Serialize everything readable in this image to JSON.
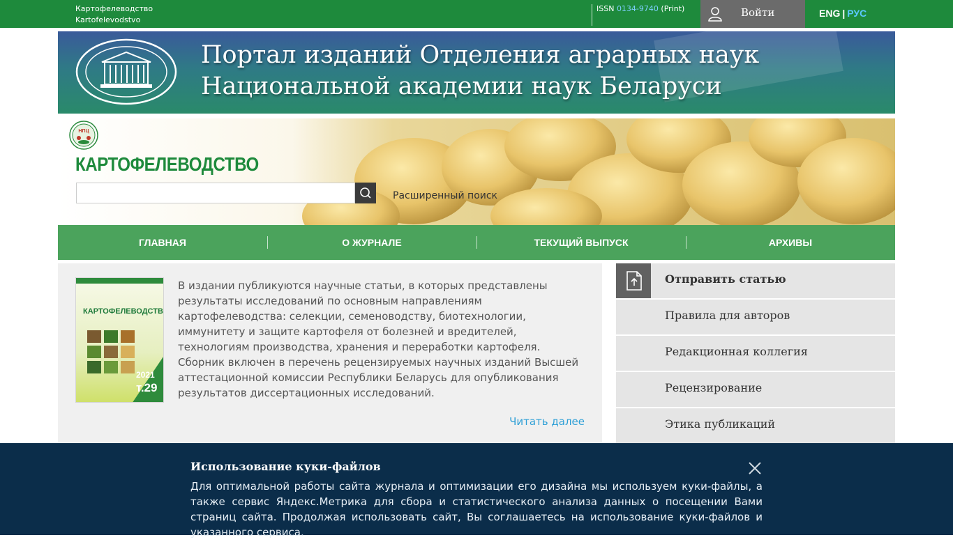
{
  "topbar": {
    "journal_ru": "Картофелеводство",
    "journal_lat": "Kartofelevodstvo",
    "issn_prefix": "ISSN",
    "issn_number": "0134-9740",
    "issn_suffix": "(Print)",
    "login_label": "Войти",
    "lang_eng": "ENG",
    "lang_sep": "|",
    "lang_rus": "РУС"
  },
  "banner": {
    "title_line1": "Портал изданий Отделения аграрных наук",
    "title_line2": "Национальной академии наук Беларуси"
  },
  "hero": {
    "journal_title": "КАРТОФЕЛЕВОДСТВО",
    "search_placeholder": "",
    "advanced_search": "Расширенный поиск"
  },
  "nav": {
    "items": [
      "ГЛАВНАЯ",
      "О ЖУРНАЛЕ",
      "ТЕКУЩИЙ ВЫПУСК",
      "АРХИВЫ"
    ]
  },
  "about": {
    "description": "В издании публикуются научные статьи, в которых представлены результаты исследований по основным направлениям картофелеводства: селекции, семеноводству, биотехнологии, иммунитету и защите картофеля от болезней и вредителей, технологиям производства, хранения и переработки картофеля.  Сборник включен в перечень рецензируемых научных изданий Высшей аттестационной комиссии Республики Беларусь для опубликования результатов диссертационных исследований.",
    "read_more": "Читать далее",
    "cover": {
      "title": "КАРТОФЕЛЕВОДСТВО",
      "year": "2021",
      "volume": "т.29"
    }
  },
  "sidebar": {
    "items": [
      {
        "label": "Отправить статью",
        "icon": "document-upload-icon"
      },
      {
        "label": "Правила для авторов"
      },
      {
        "label": "Редакционная коллегия"
      },
      {
        "label": "Рецензирование"
      },
      {
        "label": "Этика публикаций"
      }
    ]
  },
  "cookie": {
    "title": "Использование куки-файлов",
    "text": "Для оптимальной работы сайта журнала и оптимизации его дизайна мы используем куки-файлы, а также сервис Яндекс.Метрика для сбора и статистического анализа данных о посещении Вами страниц сайта. Продолжая использовать сайт, Вы соглашаетесь на использование куки-файлов и указанного сервиса."
  },
  "colors": {
    "brand_green": "#1e8a3c",
    "link_blue": "#2d9fd6",
    "cookie_bg": "#0b2d4a",
    "sidebar_icon_bg": "#616161"
  }
}
